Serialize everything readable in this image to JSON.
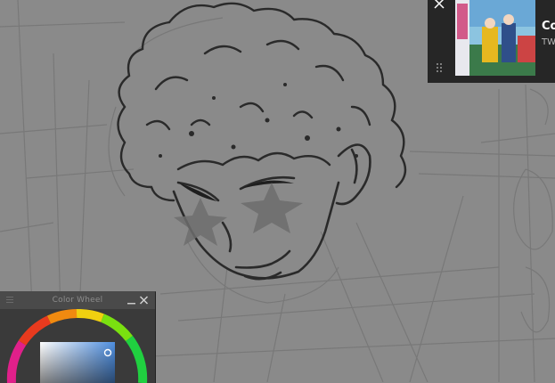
{
  "colors": {
    "canvas_bg": "#8a8a8a",
    "sketch_line": "#2a2a2a",
    "panel_bg": "#3a3a3a",
    "overlay_bg": "#262626"
  },
  "color_wheel": {
    "title": "Color Wheel",
    "selected_color": "#5f9ee0",
    "icons": {
      "grip": "grip-icon",
      "minimize": "minimize-icon",
      "close": "close-icon"
    }
  },
  "media": {
    "title": "Co",
    "artist": "TW",
    "icons": {
      "close": "close-icon",
      "grip": "drag-handle-icon"
    }
  }
}
